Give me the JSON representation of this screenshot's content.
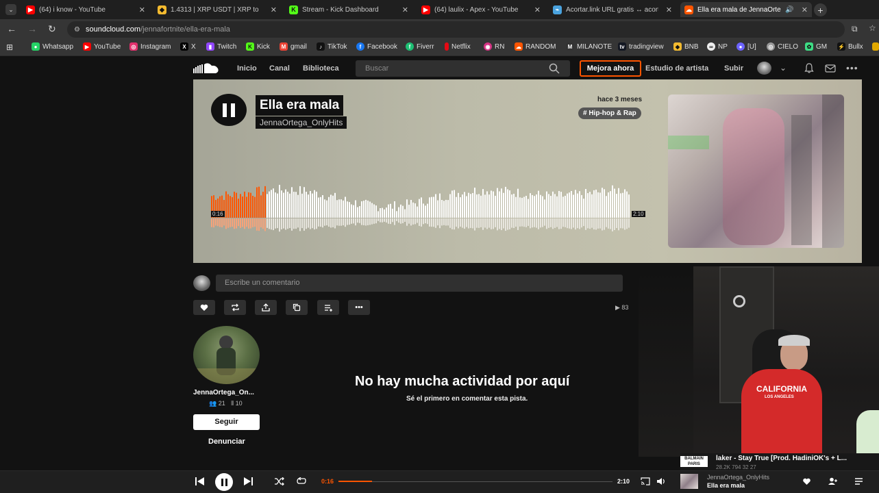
{
  "browser": {
    "tabs": [
      {
        "title": "(64) i know - YouTube",
        "favicon": "youtube-icon",
        "color": "#ff0000"
      },
      {
        "title": "1.4313 | XRP USDT | XRP to USDT",
        "favicon": "binance-icon",
        "color": "#f3ba2f"
      },
      {
        "title": "Stream - Kick Dashboard",
        "favicon": "kick-icon",
        "color": "#53fc18"
      },
      {
        "title": "(64) laulix - Apex - YouTube",
        "favicon": "youtube-icon",
        "color": "#ff0000"
      },
      {
        "title": "Acortar.link URL gratis ↔ acortar...",
        "favicon": "link-icon",
        "color": "#4aa3df"
      },
      {
        "title": "Ella era mala de JennaOrtega...",
        "favicon": "soundcloud-icon",
        "color": "#ff5500"
      }
    ],
    "url_host": "soundcloud.com",
    "url_path": "/jennafortnite/ella-era-mala",
    "bookmarks": [
      {
        "label": "Whatsapp",
        "color": "#25d366"
      },
      {
        "label": "YouTube",
        "color": "#ff0000"
      },
      {
        "label": "Instagram",
        "color": "#e1306c"
      },
      {
        "label": "X",
        "color": "#000000"
      },
      {
        "label": "Twitch",
        "color": "#9146ff"
      },
      {
        "label": "Kick",
        "color": "#53fc18"
      },
      {
        "label": "gmail",
        "color": "#ea4335"
      },
      {
        "label": "TikTok",
        "color": "#111111"
      },
      {
        "label": "Facebook",
        "color": "#1877f2"
      },
      {
        "label": "Fiverr",
        "color": "#1dbf73"
      },
      {
        "label": "Netflix",
        "color": "#e50914"
      },
      {
        "label": "RN",
        "color": "#d63384"
      },
      {
        "label": "RANDOM",
        "color": "#ff5500"
      },
      {
        "label": "MILANOTE",
        "color": "#333333"
      },
      {
        "label": "tradingview",
        "color": "#131722"
      },
      {
        "label": "BNB",
        "color": "#f3ba2f"
      },
      {
        "label": "NP",
        "color": "#eeeeee"
      },
      {
        "label": "[U]",
        "color": "#6c63ff"
      },
      {
        "label": "CIELO",
        "color": "#999999"
      },
      {
        "label": "GM",
        "color": "#3ddc84"
      },
      {
        "label": "Bullx",
        "color": "#111111"
      }
    ]
  },
  "soundcloud": {
    "nav": [
      "Inicio",
      "Canal",
      "Biblioteca"
    ],
    "search_placeholder": "Buscar",
    "upgrade_label": "Mejora ahora",
    "artist_studio": "Estudio de artista",
    "upload": "Subir",
    "accent": "#ff5500"
  },
  "track": {
    "title": "Ella era mala",
    "artist": "JennaOrtega_OnlyHits",
    "released": "hace 3 meses",
    "genre": "# Hip-hop & Rap",
    "current_time": "0:16",
    "total_time": "2:10",
    "progress": 0.123,
    "plays": "83"
  },
  "comments": {
    "placeholder": "Escribe un comentario",
    "empty_title": "No hay mucha actividad por aquí",
    "empty_subtitle": "Sé el primero en comentar esta pista."
  },
  "artist": {
    "name": "JennaOrtega_On...",
    "followers": "21",
    "tracks": "10",
    "follow_label": "Seguir",
    "report_label": "Denunciar"
  },
  "overlay": {
    "brand": "BALMAIN",
    "brand_sub": "PARIS",
    "now_playing": "laker - Stay True [Prod. HadiniOK's + L...",
    "stats": "28.2K   794   32   27",
    "shirt_text": "CALIFORNIA",
    "shirt_sub": "LOS ANGELES"
  },
  "player": {
    "artist": "JennaOrtega_OnlyHits",
    "title": "Ella era mala"
  }
}
